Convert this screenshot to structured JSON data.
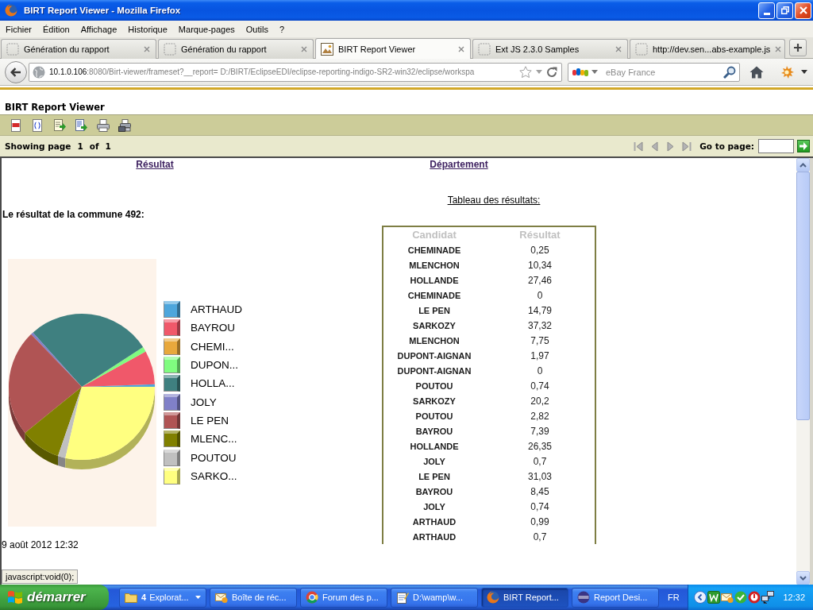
{
  "window": {
    "title": "BIRT Report Viewer - Mozilla Firefox"
  },
  "menu": [
    "Fichier",
    "Édition",
    "Affichage",
    "Historique",
    "Marque-pages",
    "Outils",
    "?"
  ],
  "tabs": [
    {
      "label": "Génération du rapport",
      "kind": "blank",
      "selected": false
    },
    {
      "label": "Génération du rapport",
      "kind": "blank",
      "selected": false
    },
    {
      "label": "BIRT Report Viewer",
      "kind": "birt",
      "selected": true
    },
    {
      "label": "Ext JS 2.3.0 Samples",
      "kind": "blank",
      "selected": false
    },
    {
      "label": "http://dev.sen...abs-example.js",
      "kind": "blank",
      "selected": false
    }
  ],
  "address_bar": {
    "host": "10.1.0.106",
    "path": ":8080/Birt-viewer/frameset?__report= D:/BIRT/EclipseEDI/eclipse-reporting-indigo-SR2-win32/eclipse/workspa"
  },
  "search": {
    "placeholder": "eBay France"
  },
  "viewer": {
    "title": "BIRT Report Viewer",
    "page_label": "Showing page",
    "page": "1",
    "of_label": "of",
    "total": "1",
    "goto_label": "Go to page:"
  },
  "report": {
    "links": [
      "Résultat",
      "Département"
    ],
    "table_caption": "Tableau des résultats:",
    "heading": "Le résultat de la commune 492:",
    "legend": [
      {
        "label": "ARTHAUD",
        "color": "#4ea6dc"
      },
      {
        "label": "BAYROU",
        "color": "#f0586a"
      },
      {
        "label": "CHEMI...",
        "color": "#e8a83c"
      },
      {
        "label": "DUPON...",
        "color": "#80fc80"
      },
      {
        "label": "HOLLA...",
        "color": "#3f8080"
      },
      {
        "label": "JOLY",
        "color": "#8080c8"
      },
      {
        "label": "LE PEN",
        "color": "#b05454"
      },
      {
        "label": "MLENC...",
        "color": "#808000"
      },
      {
        "label": "POUTOU",
        "color": "#c0c0c0"
      },
      {
        "label": "SARKO...",
        "color": "#ffff80"
      }
    ],
    "table": {
      "columns": [
        "Candidat",
        "Résultat"
      ],
      "rows": [
        [
          "CHEMINADE",
          "0,25"
        ],
        [
          "MLENCHON",
          "10,34"
        ],
        [
          "HOLLANDE",
          "27,46"
        ],
        [
          "CHEMINADE",
          "0"
        ],
        [
          "LE PEN",
          "14,79"
        ],
        [
          "SARKOZY",
          "37,32"
        ],
        [
          "MLENCHON",
          "7,75"
        ],
        [
          "DUPONT-AIGNAN",
          "1,97"
        ],
        [
          "DUPONT-AIGNAN",
          "0"
        ],
        [
          "POUTOU",
          "0,74"
        ],
        [
          "SARKOZY",
          "20,2"
        ],
        [
          "POUTOU",
          "2,82"
        ],
        [
          "BAYROU",
          "7,39"
        ],
        [
          "HOLLANDE",
          "26,35"
        ],
        [
          "JOLY",
          "0,7"
        ],
        [
          "LE PEN",
          "31,03"
        ],
        [
          "BAYROU",
          "8,45"
        ],
        [
          "JOLY",
          "0,74"
        ],
        [
          "ARTHAUD",
          "0,99"
        ],
        [
          "ARTHAUD",
          "0,7"
        ]
      ]
    },
    "date": "9 août 2012 12:32"
  },
  "status_text": "javascript:void(0);",
  "taskbar": {
    "start": "démarrer",
    "tasks": [
      {
        "count": "4",
        "label": "Explorat...",
        "kind": "folder",
        "grouped": true,
        "selected": false
      },
      {
        "label": "Boîte de réc...",
        "kind": "mail",
        "grouped": false,
        "selected": false
      },
      {
        "label": "Forum des p...",
        "kind": "chrome",
        "grouped": false,
        "selected": false
      },
      {
        "label": "D:\\wamp\\w...",
        "kind": "notepad",
        "grouped": false,
        "selected": false
      },
      {
        "label": "BIRT Report...",
        "kind": "firefox",
        "grouped": false,
        "selected": true
      },
      {
        "label": "Report Desi...",
        "kind": "eclipse",
        "grouped": false,
        "selected": false
      }
    ],
    "language": "FR",
    "clock": "12:32"
  }
}
